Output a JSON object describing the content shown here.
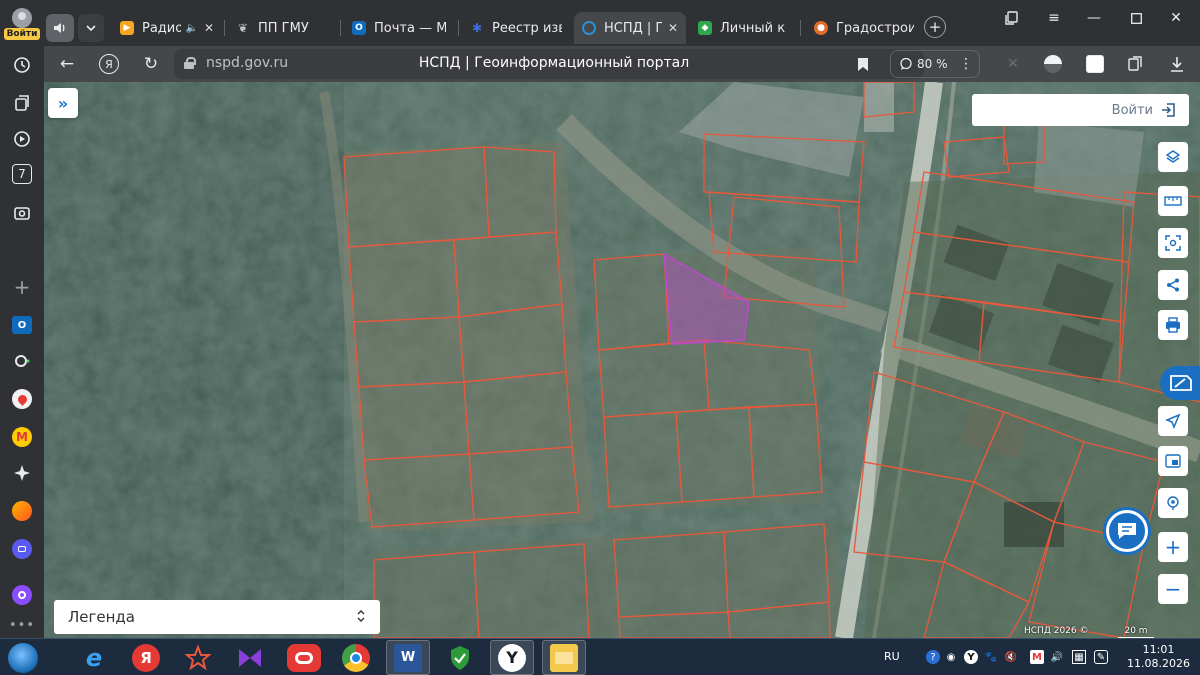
{
  "sidebar": {
    "login_badge": "Войти",
    "extension_number": "7"
  },
  "tabs": [
    {
      "label": "Радио |",
      "icon": "yandex-music-icon",
      "color": "#f5a623"
    },
    {
      "label": "ПП ГМУ",
      "icon": "emblem-icon",
      "color": "#9aa0a6"
    },
    {
      "label": "Почта — Ма",
      "icon": "outlook-icon",
      "color": "#0f6cbd"
    },
    {
      "label": "Реестр изве",
      "icon": "registry-icon",
      "color": "#3c6ee0"
    },
    {
      "label": "НСПД | Ге",
      "icon": "nspd-icon",
      "color": "#2a8fd6"
    },
    {
      "label": "Личный каб",
      "icon": "cabinet-icon",
      "color": "#2fa84f"
    },
    {
      "label": "Градостроит",
      "icon": "city-icon",
      "color": "#e26b2a"
    }
  ],
  "address_bar": {
    "url": "nspd.gov.ru",
    "page_title": "НСПД | Геоинформационный портал",
    "zoom": "80 %"
  },
  "map": {
    "login_label": "Войти",
    "legend_label": "Легенда",
    "copyright": "НСПД 2026 ©",
    "scale_label": "20 m"
  },
  "taskbar": {
    "language": "RU",
    "time": "11:01",
    "date": "11.08.2026"
  },
  "colors": {
    "parcel_line": "#e8583a",
    "selected_parcel": "#b84cc8",
    "accent": "#1a6fc2"
  }
}
